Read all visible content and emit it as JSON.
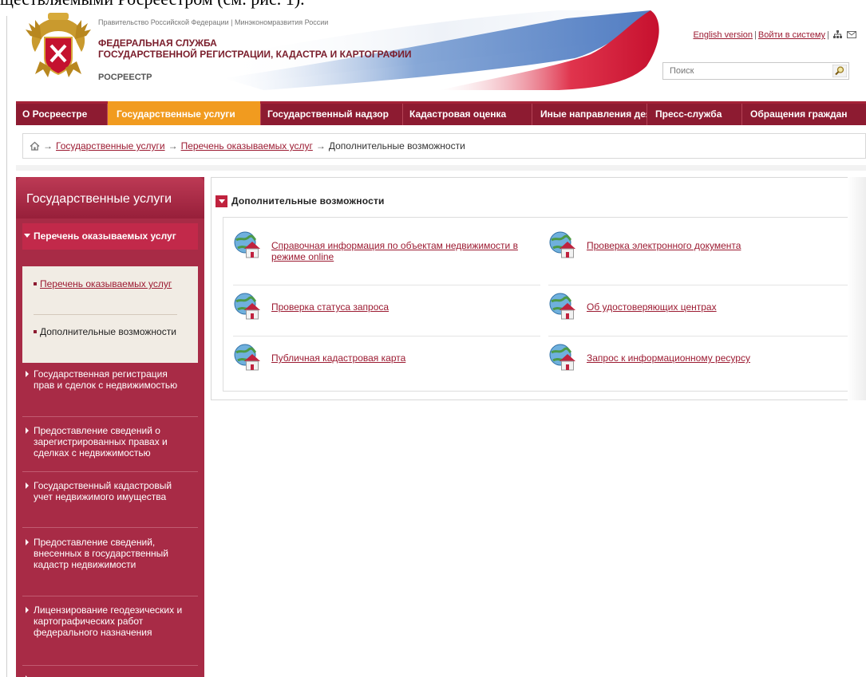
{
  "doc_caption": "ществляемыми Росреестром (см. рис. 1).",
  "header": {
    "gov_line": "Правительство Российской Федерации | Минэкономразвития России",
    "agency_name": "ФЕДЕРАЛЬНАЯ СЛУЖБА\nГОСУДАРСТВЕННОЙ РЕГИСТРАЦИИ, КАДАСТРА И КАРТОГРАФИИ",
    "agency_short": "РОСРЕЕСТР",
    "english_link": "English version",
    "login_link": "Войти в систему",
    "separator": "|",
    "search_placeholder": "Поиск",
    "colors": {
      "brand": "#8d1b31",
      "accent": "#f19b1f",
      "link": "#9c1b32"
    }
  },
  "nav": {
    "items": [
      {
        "label": "О Росреестре",
        "active": false
      },
      {
        "label": "Государственные услуги",
        "active": true
      },
      {
        "label": "Государственный надзор",
        "active": false
      },
      {
        "label": "Кадастровая оценка",
        "active": false
      },
      {
        "label": "Иные направления деятельности",
        "active": false
      },
      {
        "label": "Пресс-служба",
        "active": false
      },
      {
        "label": "Обращения граждан",
        "active": false
      }
    ]
  },
  "breadcrumb": {
    "home_icon": "home-icon",
    "arrow": "→",
    "links": [
      "Государственные услуги",
      "Перечень оказываемых услуг"
    ],
    "current": "Дополнительные возможности"
  },
  "sidebar": {
    "title": "Государственные услуги",
    "open_item": "Перечень оказываемых услуг",
    "sub_items": [
      {
        "label": "Перечень оказываемых услуг",
        "link": true
      },
      {
        "label": "Дополнительные возможности",
        "link": false
      }
    ],
    "items": [
      "Государственная регистрация прав и сделок с недвижимостью",
      "Предоставление сведений о зарегистрированных правах и сделках с недвижимостью",
      "Государственный кадастровый учет недвижимого имущества",
      "Предоставление сведений, внесенных в государственный кадастр недвижимости",
      "Лицензирование геодезических и картографических работ федерального назначения"
    ]
  },
  "content": {
    "section_title": "Дополнительные возможности",
    "services": [
      "Справочная информация по объектам недвижимости в режиме online",
      "Проверка электронного документа",
      "Проверка статуса запроса",
      "Об удостоверяющих центрах",
      "Публичная кадастровая карта",
      "Запрос к информационному ресурсу"
    ]
  }
}
